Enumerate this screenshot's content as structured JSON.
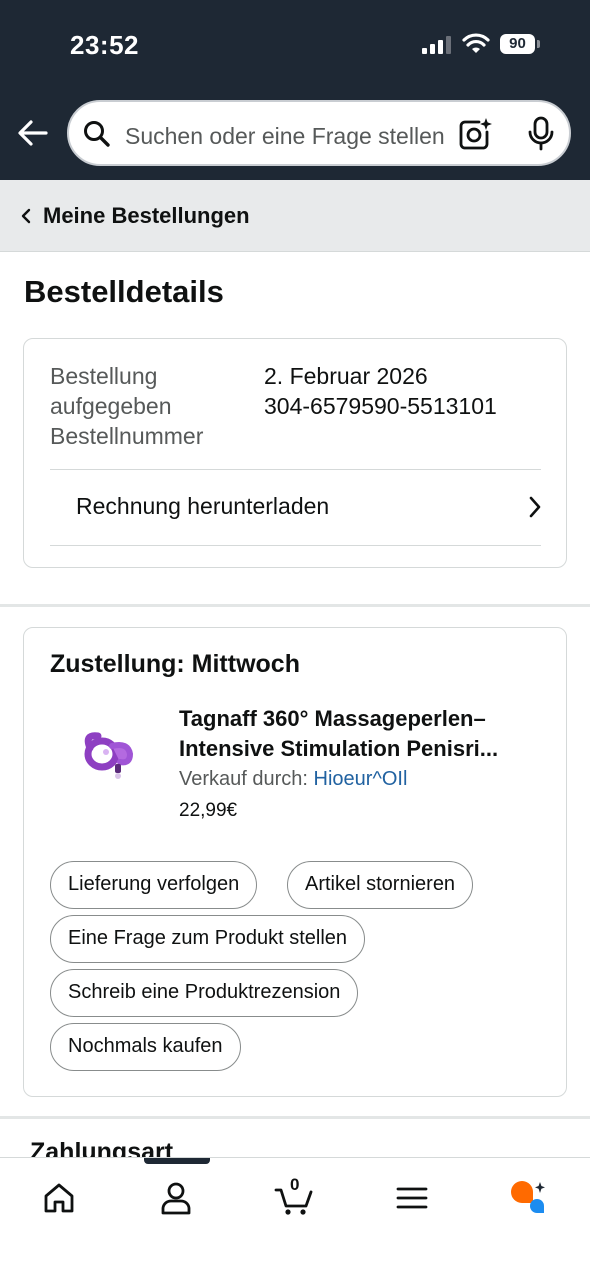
{
  "status_bar": {
    "time": "23:52",
    "battery": "90"
  },
  "search": {
    "placeholder": "Suchen oder eine Frage stellen"
  },
  "breadcrumb": {
    "label": "Meine Bestellungen"
  },
  "page": {
    "title": "Bestelldetails"
  },
  "order": {
    "placed_label": "Bestellung aufgegeben",
    "placed_label_line1": "Bestellung",
    "placed_label_line2": "aufgegeben",
    "placed_value": "2. Februar 2026",
    "number_label": "Bestellnummer",
    "number_value": "304-6579590-5513101",
    "invoice_label": "Rechnung herunterladen"
  },
  "shipment": {
    "heading": "Zustellung: Mittwoch",
    "product": {
      "title_line1": "Tagnaff 360° Massageperlen–",
      "title_line2": "Intensive Stimulation Penisri...",
      "sold_by_label": "Verkauf durch:",
      "seller": "Hioeur^OIl",
      "price": "22,99€"
    },
    "actions": [
      {
        "label": "Lieferung verfolgen"
      },
      {
        "label": "Artikel stornieren"
      },
      {
        "label": "Eine Frage zum Produkt stellen"
      },
      {
        "label": "Schreib eine Produktrezension"
      },
      {
        "label": "Nochmals kaufen"
      }
    ]
  },
  "payment": {
    "heading": "Zahlungsart"
  },
  "bottom_nav": {
    "items": [
      {
        "icon": "home-icon"
      },
      {
        "icon": "account-icon"
      },
      {
        "icon": "cart-icon",
        "count": "0"
      },
      {
        "icon": "menu-icon"
      },
      {
        "icon": "rufus-assistant-icon"
      }
    ]
  },
  "colors": {
    "header_bg": "#1e2834",
    "link": "#2162a1",
    "product_purple": "#8e3fc2",
    "assistant_orange": "#ff6a00",
    "assistant_blue": "#1c8cf0"
  }
}
